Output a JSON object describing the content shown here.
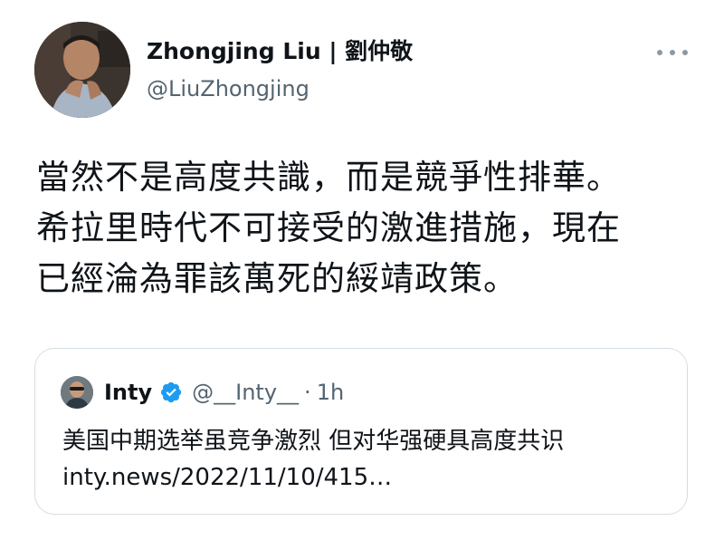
{
  "tweet": {
    "author": {
      "name": "Zhongjing Liu | 劉仲敬",
      "handle": "@LiuZhongjing"
    },
    "text_lines": [
      "當然不是高度共識，而是競爭性排華。",
      "希拉里時代不可接受的激進措施，現在",
      "已經淪為罪該萬死的綏靖政策。"
    ]
  },
  "quoted_tweet": {
    "name": "Inty",
    "handle": "@__Inty__",
    "separator": "·",
    "time": "1h",
    "text_lines": [
      "美国中期选举虽竞争激烈 但对华强硬具高度共识",
      "inty.news/2022/11/10/415…"
    ]
  },
  "icons": {
    "more": "more-options-icon",
    "verified": "verified-badge-icon"
  },
  "colors": {
    "text_primary": "#0f1419",
    "text_secondary": "#536471",
    "verified_blue": "#1d9bf0",
    "card_border": "#d5dde3"
  }
}
